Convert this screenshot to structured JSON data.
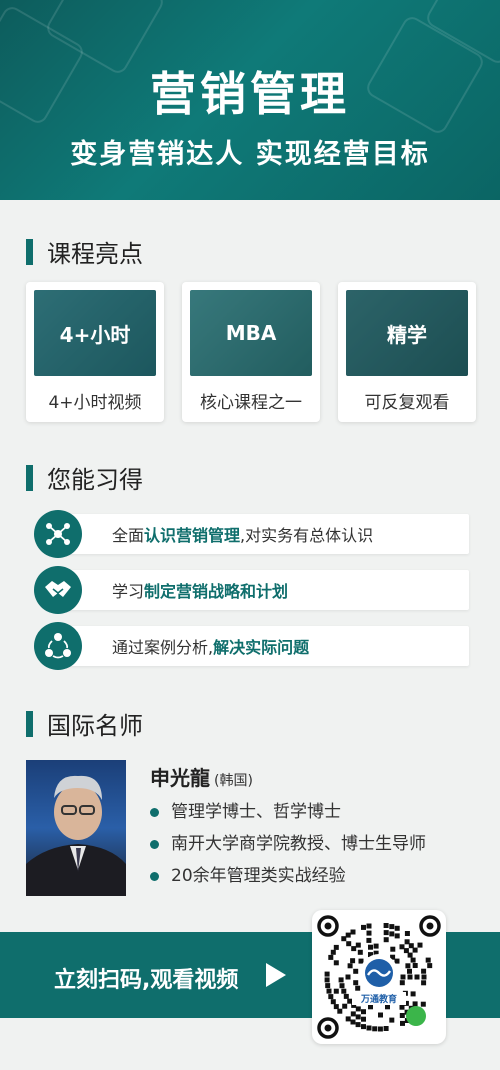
{
  "hero": {
    "title": "营销管理",
    "subtitle": "变身营销达人 实现经营目标"
  },
  "sections": {
    "highlights_title": "课程亮点",
    "learn_title": "您能习得",
    "teacher_title": "国际名师"
  },
  "highlights": [
    {
      "overlay": "4+小时",
      "caption": "4+小时视频"
    },
    {
      "overlay": "MBA",
      "caption": "核心课程之一"
    },
    {
      "overlay": "精学",
      "caption": "可反复观看"
    }
  ],
  "learn": [
    {
      "prefix": "全面",
      "bold": "认识营销管理",
      "suffix": ",对实务有总体认识",
      "icon": "network-icon"
    },
    {
      "prefix": "学习",
      "bold": "制定营销战略和计划",
      "suffix": "",
      "icon": "handshake-icon"
    },
    {
      "prefix": "通过案例分析,",
      "bold": "解决实际问题",
      "suffix": "",
      "icon": "cycle-icon"
    }
  ],
  "teacher": {
    "name": "申光龍",
    "country": "(韩国)",
    "bullets": [
      "管理学博士、哲学博士",
      "南开大学商学院教授、博士生导师",
      "20余年管理类实战经验"
    ]
  },
  "cta": {
    "text": "立刻扫码,观看视频",
    "qr_label": "万通教育"
  },
  "colors": {
    "accent": "#0f6e6c",
    "background": "#f0f2f1"
  }
}
